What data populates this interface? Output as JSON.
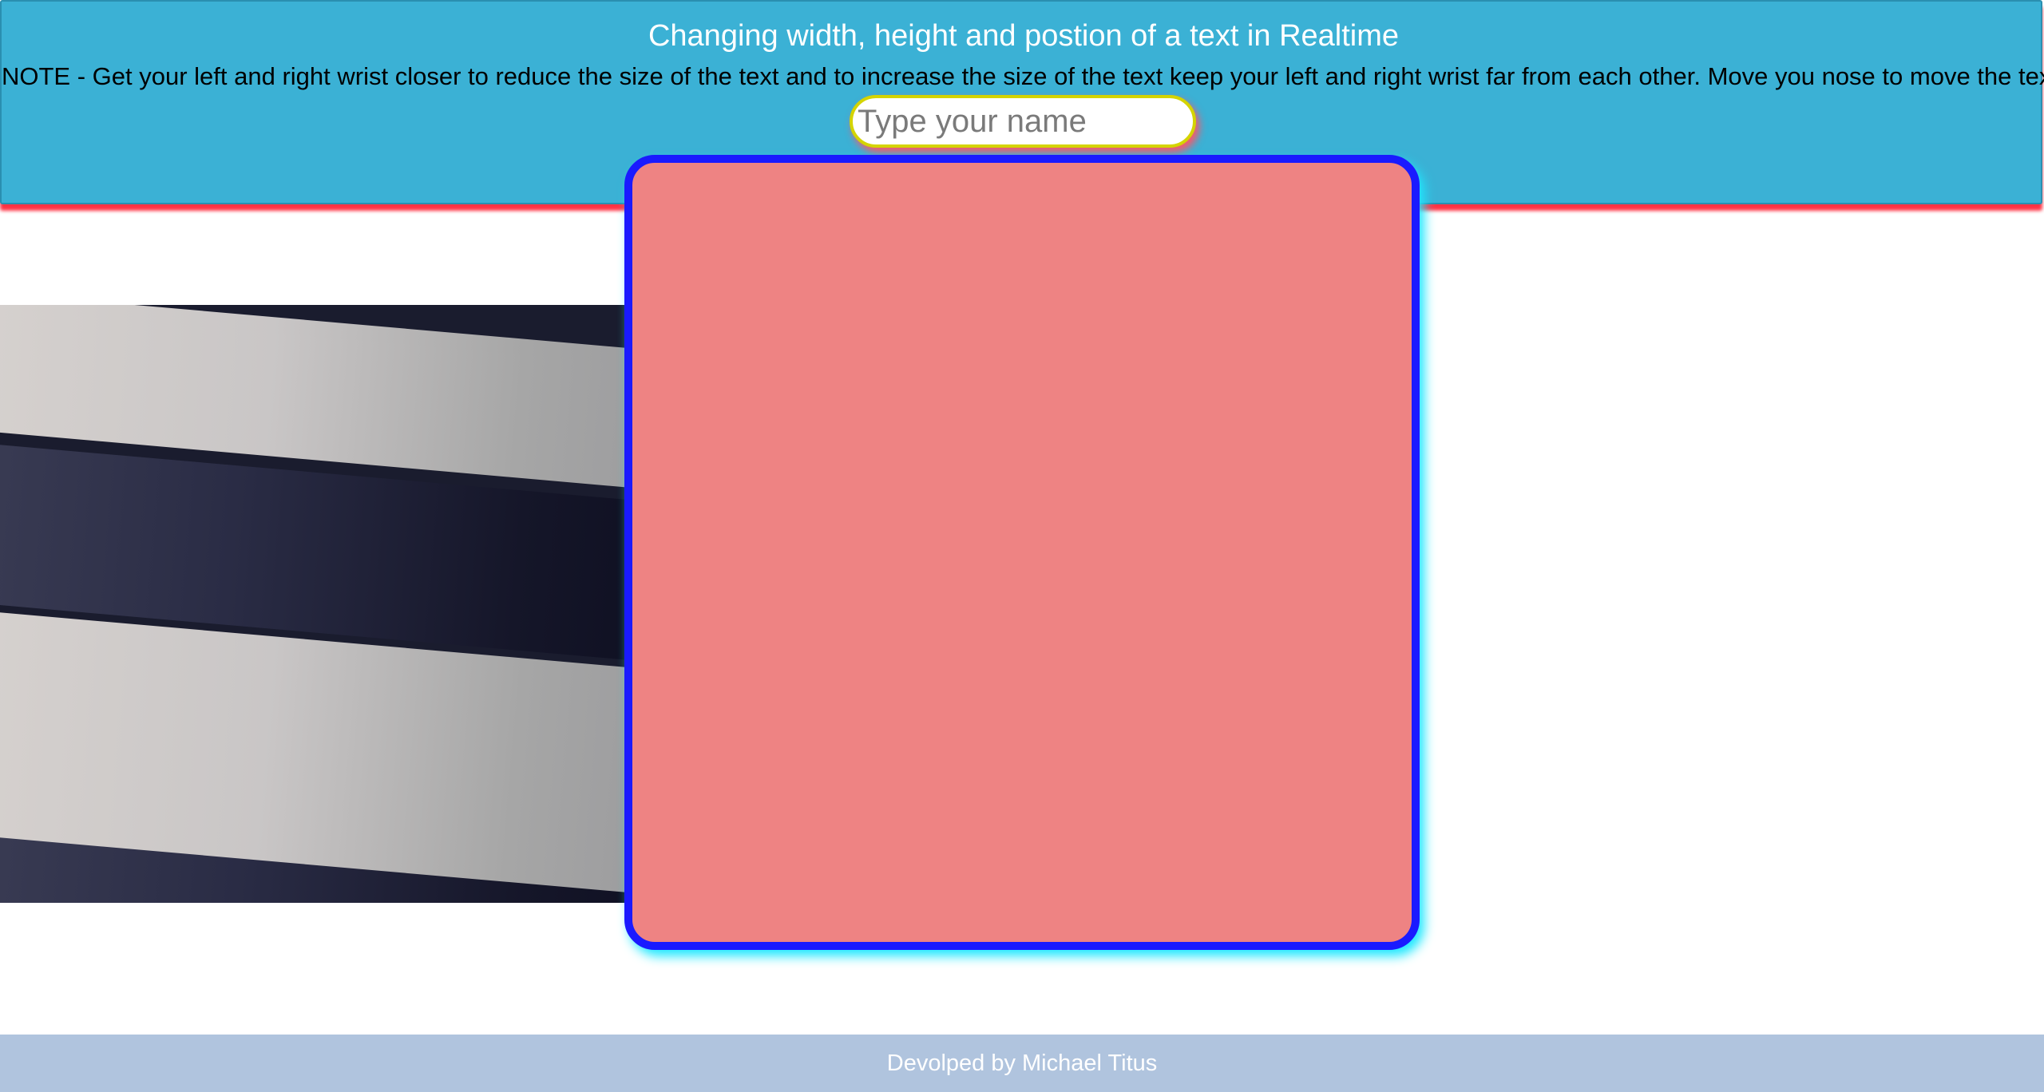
{
  "header": {
    "title": "Changing width, height and postion of a text in Realtime",
    "note": "NOTE - Get your left and right wrist closer to reduce the size of the text and to increase the size of the text keep your left and right wrist far from each other. Move you nose to move the text",
    "name_input": {
      "placeholder": "Type your name",
      "value": ""
    }
  },
  "main": {
    "webcam": {
      "description_icon": "webcam-feed"
    },
    "canvas": {
      "text": ""
    }
  },
  "footer": {
    "credit": "Devolped by Michael Titus"
  },
  "colors": {
    "header_bg": "#3bb1d5",
    "header_shadow": "#ff3344",
    "canvas_bg": "#ee8383",
    "canvas_border": "#1a1aff",
    "canvas_glow": "#1ee8ff",
    "input_border": "#d4d400",
    "footer_bg": "#b0c4de"
  }
}
